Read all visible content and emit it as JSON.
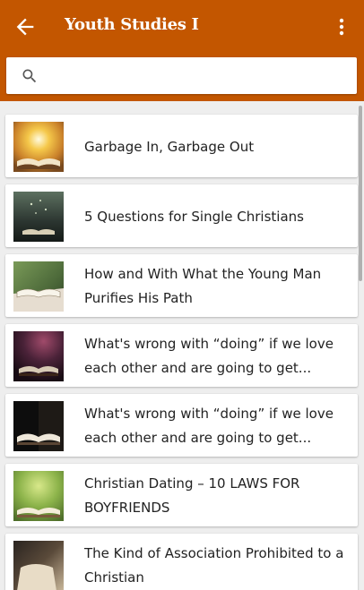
{
  "appbar": {
    "title": "Youth Studies I",
    "back_icon": "arrow-back-icon",
    "menu_icon": "more-vert-icon",
    "color": "#c35600"
  },
  "search": {
    "icon": "search-icon",
    "value": "",
    "placeholder": ""
  },
  "items": [
    {
      "title": "Garbage In, Garbage Out"
    },
    {
      "title": "5 Questions for Single Christians"
    },
    {
      "title": "How and With What the Young Man Purifies His Path"
    },
    {
      "title": "What's wrong with “doing” if we love each other and are going to get..."
    },
    {
      "title": "What's wrong with “doing” if we love each other and are going to get..."
    },
    {
      "title": "Christian Dating – 10 LAWS FOR BOYFRIENDS"
    },
    {
      "title": "The Kind of Association Prohibited to a Christian"
    }
  ]
}
